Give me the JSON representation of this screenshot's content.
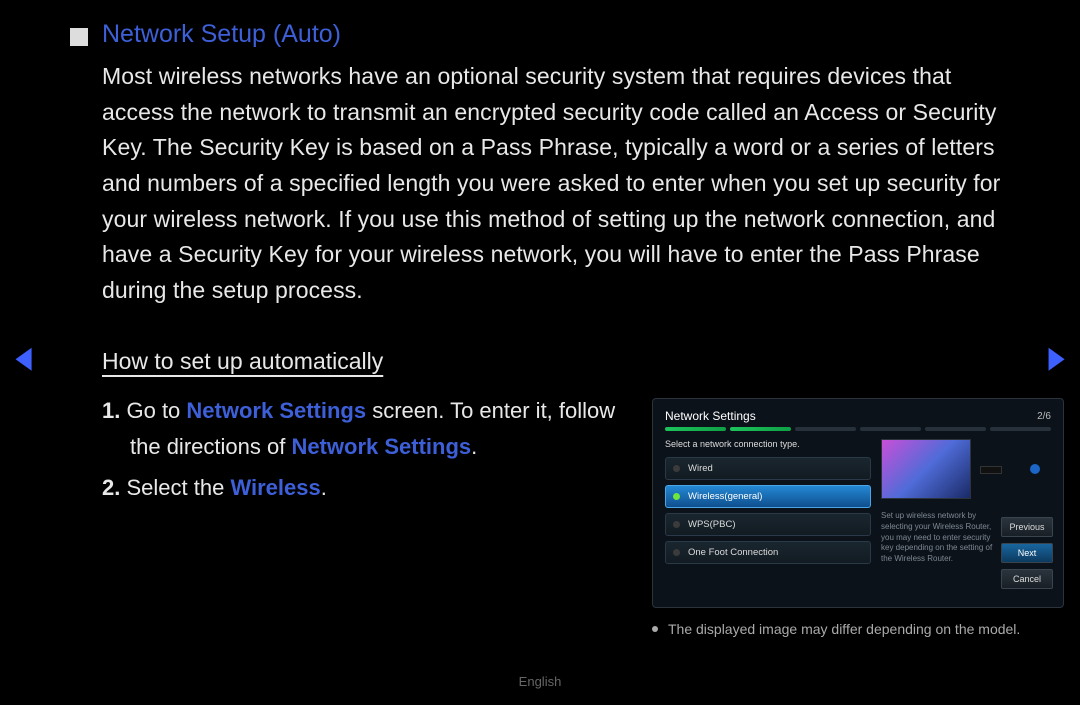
{
  "header": {
    "title": "Network Setup (Auto)"
  },
  "paragraph": "Most wireless networks have an optional security system that requires devices that access the network to transmit an encrypted security code called an Access or Security Key. The Security Key is based on a Pass Phrase, typically a word or a series of letters and numbers of a specified length you were asked to enter when you set up security for your wireless network. If you use this method of setting up the network connection, and have a Security Key for your wireless network, you will have to enter the Pass Phrase during the setup process.",
  "subheading": "How to set up automatically",
  "steps": {
    "s1": {
      "num": "1.",
      "t1": "Go to ",
      "b1": "Network Settings",
      "t2": " screen. To enter it, follow the directions of ",
      "b2": "Network Settings",
      "t3": "."
    },
    "s2": {
      "num": "2.",
      "t1": "Select the ",
      "b1": "Wireless",
      "t2": "."
    }
  },
  "inset": {
    "title": "Network Settings",
    "page": "2/6",
    "prompt": "Select a network connection type.",
    "options": {
      "wired": "Wired",
      "wireless": "Wireless(general)",
      "wps": "WPS(PBC)",
      "ofc": "One Foot Connection"
    },
    "help": "Set up wireless network by selecting your Wireless Router, you may need to enter security key depending on the setting of the Wireless Router.",
    "buttons": {
      "prev": "Previous",
      "next": "Next",
      "cancel": "Cancel"
    }
  },
  "note": "The displayed image may differ depending on the model.",
  "footer_lang": "English",
  "nav": {
    "prev": "◀",
    "next": "▶"
  }
}
